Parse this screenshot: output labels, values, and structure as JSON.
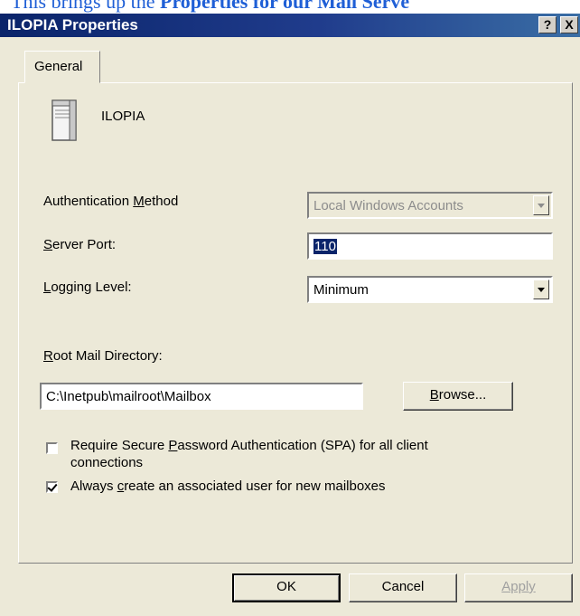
{
  "caption": {
    "prefix": "This brings up the ",
    "bold": "Properties",
    "suffix": " for our Mail Serve"
  },
  "window": {
    "title": "ILOPIA Properties",
    "help_glyph": "?",
    "close_glyph": "X"
  },
  "tabs": [
    {
      "label": "General"
    }
  ],
  "server": {
    "name": "ILOPIA",
    "icon": "server-icon"
  },
  "auth_method": {
    "label_pre": "Authentication ",
    "label_key": "M",
    "label_post": "ethod",
    "value": "Local Windows Accounts",
    "enabled": false
  },
  "server_port": {
    "label_key": "S",
    "label_post": "erver Port:",
    "value": "110"
  },
  "logging_level": {
    "label_key": "L",
    "label_post": "ogging Level:",
    "value": "Minimum"
  },
  "root_mail_dir": {
    "label_key": "R",
    "label_post": "oot Mail Directory:",
    "value": "C:\\Inetpub\\mailroot\\Mailbox"
  },
  "browse_button": {
    "key": "B",
    "label_post": "rowse..."
  },
  "require_spa": {
    "line1_pre": "Require Secure ",
    "line1_key": "P",
    "line1_post": "assword Authentication (SPA) for all client",
    "line2": "connections",
    "checked": false
  },
  "always_create": {
    "label_pre": "Always ",
    "label_key": "c",
    "label_post": "reate an associated user for new mailboxes",
    "checked": true
  },
  "footer_buttons": {
    "ok": "OK",
    "cancel": "Cancel",
    "apply": "Apply"
  },
  "colors": {
    "titlebar": "#0a246a",
    "dialog_bg": "#ece9d8",
    "caption_text": "#1f5fd6",
    "selection": "#0a246a"
  }
}
